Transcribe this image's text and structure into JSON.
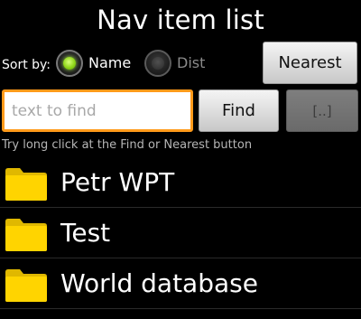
{
  "header": {
    "title": "Nav item list"
  },
  "sort": {
    "label": "Sort by:",
    "options": [
      {
        "label": "Name",
        "selected": true
      },
      {
        "label": "Dist",
        "selected": false
      }
    ]
  },
  "buttons": {
    "nearest": "Nearest",
    "find": "Find",
    "browse": "[..]"
  },
  "search": {
    "value": "",
    "placeholder": "text to find"
  },
  "hint": "Try long click at the Find or Nearest button",
  "items": [
    {
      "label": "Petr WPT",
      "icon": "folder-icon"
    },
    {
      "label": "Test",
      "icon": "folder-icon"
    },
    {
      "label": "World database",
      "icon": "folder-icon"
    }
  ],
  "colors": {
    "background": "#000000",
    "search_focus_border": "#ff9a1a",
    "radio_selected": "#8fd61a",
    "folder": "#ffd400"
  }
}
